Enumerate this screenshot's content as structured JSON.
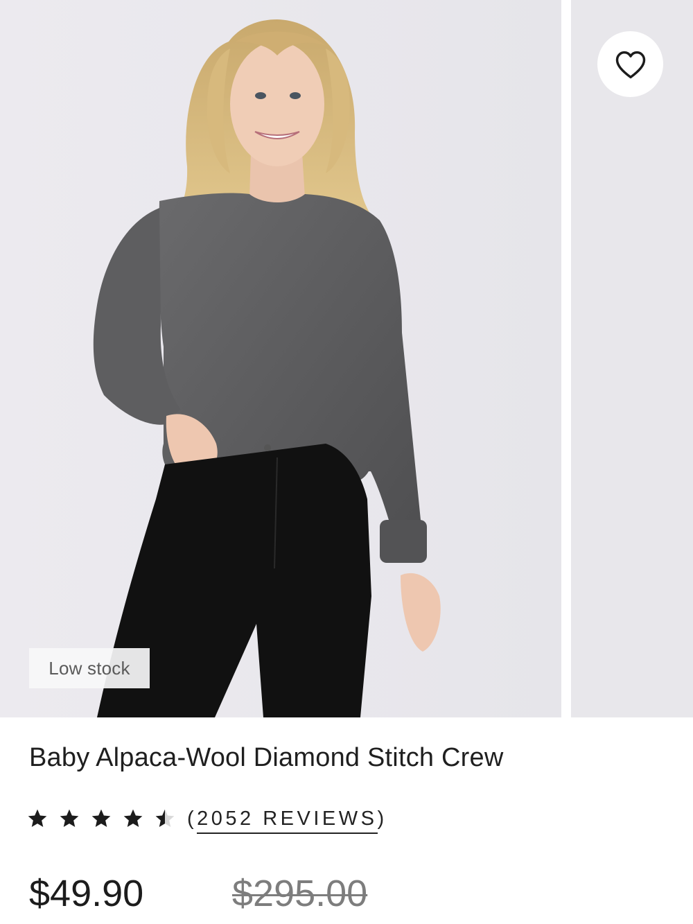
{
  "product": {
    "stock_badge": "Low stock",
    "title": "Baby Alpaca-Wool Diamond Stitch Crew",
    "rating": 4.5,
    "rating_max": 5,
    "reviews_open": "(",
    "reviews_label": "2052 REVIEWS",
    "reviews_close": ")",
    "price": "$49.90",
    "compare_price": "$295.00"
  },
  "icons": {
    "favorite": "heart-outline-icon",
    "star_full": "star-filled-icon",
    "star_half": "star-half-icon"
  },
  "colors": {
    "photo_background": "#e9e8ec",
    "sweater": "#5f5f61",
    "pants": "#111111",
    "text": "#1c1c1c",
    "muted": "#7d7d7d"
  }
}
